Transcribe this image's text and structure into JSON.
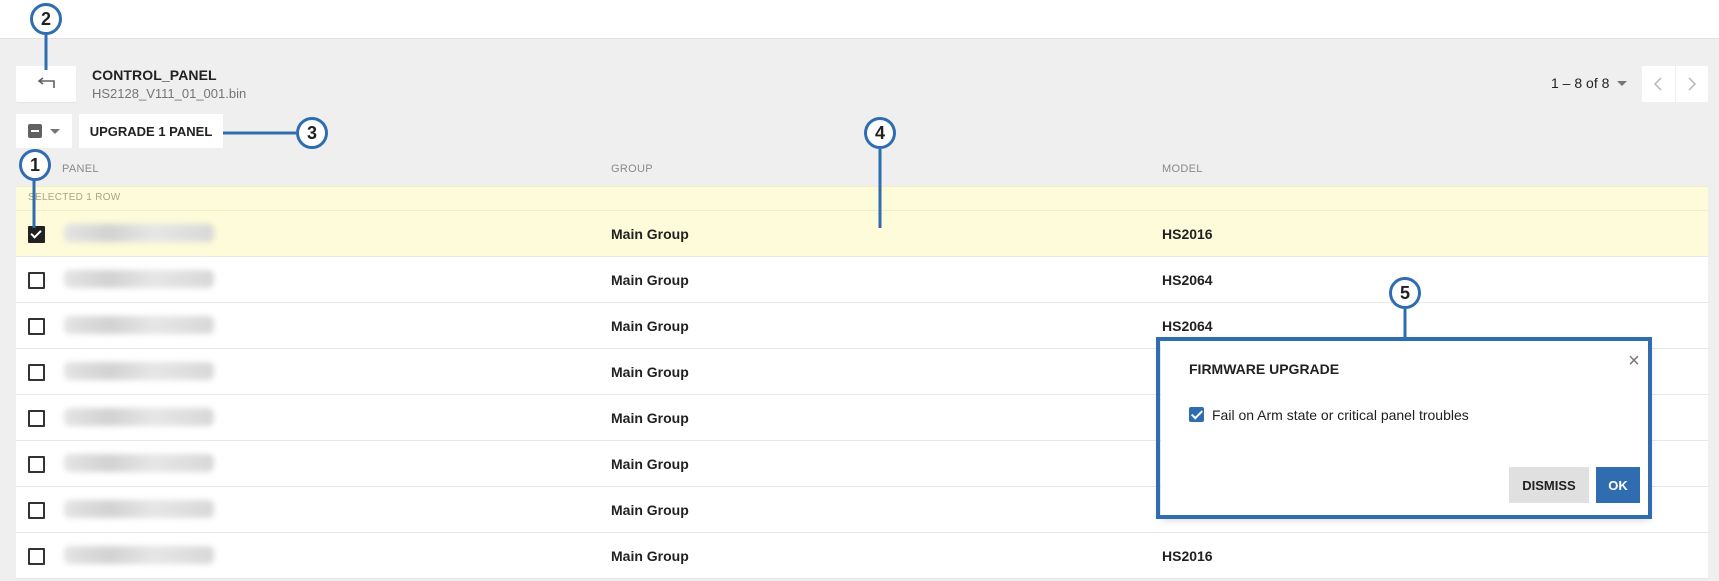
{
  "header": {
    "title": "CONTROL_PANEL",
    "subtitle": "HS2128_V111_01_001.bin"
  },
  "pagination": {
    "range": "1 – 8 of 8"
  },
  "toolbar": {
    "upgrade_label": "UPGRADE 1 PANEL"
  },
  "table": {
    "columns": [
      "PANEL",
      "GROUP",
      "MODEL"
    ],
    "selected_banner": "SELECTED 1 ROW",
    "rows": [
      {
        "group": "Main Group",
        "model": "HS2016",
        "checked": true
      },
      {
        "group": "Main Group",
        "model": "HS2064",
        "checked": false
      },
      {
        "group": "Main Group",
        "model": "HS2064",
        "checked": false
      },
      {
        "group": "Main Group",
        "model": "",
        "checked": false
      },
      {
        "group": "Main Group",
        "model": "",
        "checked": false
      },
      {
        "group": "Main Group",
        "model": "",
        "checked": false
      },
      {
        "group": "Main Group",
        "model": "",
        "checked": false
      },
      {
        "group": "Main Group",
        "model": "HS2016",
        "checked": false
      }
    ]
  },
  "dialog": {
    "title": "FIRMWARE UPGRADE",
    "option_label": "Fail on Arm state or critical panel troubles",
    "option_checked": true,
    "dismiss_label": "DISMISS",
    "ok_label": "OK",
    "close_symbol": "×"
  },
  "icons": {
    "back": "back-arrow-icon",
    "close": "close-icon",
    "prev": "chevron-left-icon",
    "next": "chevron-right-icon"
  },
  "callouts": [
    "1",
    "2",
    "3",
    "4",
    "5"
  ],
  "colors": {
    "accent": "#2f6db0",
    "selected_row": "#fdfbd9",
    "background": "#efefef"
  }
}
